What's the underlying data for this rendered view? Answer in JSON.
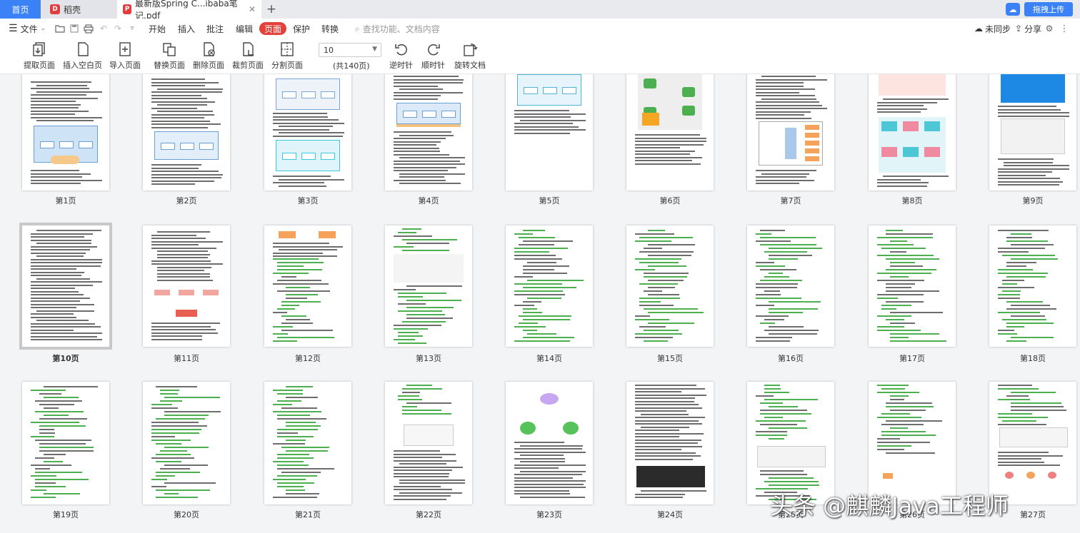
{
  "tabs": {
    "home": "首页",
    "shell": "稻壳",
    "doc": "最新版Spring C...ibaba笔记.pdf"
  },
  "cloud": {
    "upload": "拖拽上传"
  },
  "menu": {
    "file": "文件",
    "items": [
      "开始",
      "插入",
      "批注",
      "编辑",
      "页面",
      "保护",
      "转换"
    ],
    "active_index": 4,
    "search_placeholder": "查找功能、文档内容",
    "unsync": "未同步",
    "share": "分享"
  },
  "toolbar": {
    "extract": "提取页面",
    "insert_blank": "插入空白页",
    "import": "导入页面",
    "replace": "替换页面",
    "delete": "删除页面",
    "crop": "裁剪页面",
    "split": "分割页面",
    "zoom": "10",
    "total": "(共140页)",
    "ccw": "逆时针",
    "cw": "顺时针",
    "rotate": "旋转文档"
  },
  "pages": [
    "第1页",
    "第2页",
    "第3页",
    "第4页",
    "第5页",
    "第6页",
    "第7页",
    "第8页",
    "第9页",
    "第10页",
    "第11页",
    "第12页",
    "第13页",
    "第14页",
    "第15页",
    "第16页",
    "第17页",
    "第18页",
    "第19页",
    "第20页",
    "第21页",
    "第22页",
    "第23页",
    "第24页",
    "第25页",
    "第26页",
    "第27页"
  ],
  "selected_page": 10,
  "watermark": "头条 @麒麟Java工程师",
  "colors": {
    "accent": "#3b82f6",
    "active_menu": "#e5413a",
    "pdf_red": "#e23c3c"
  }
}
